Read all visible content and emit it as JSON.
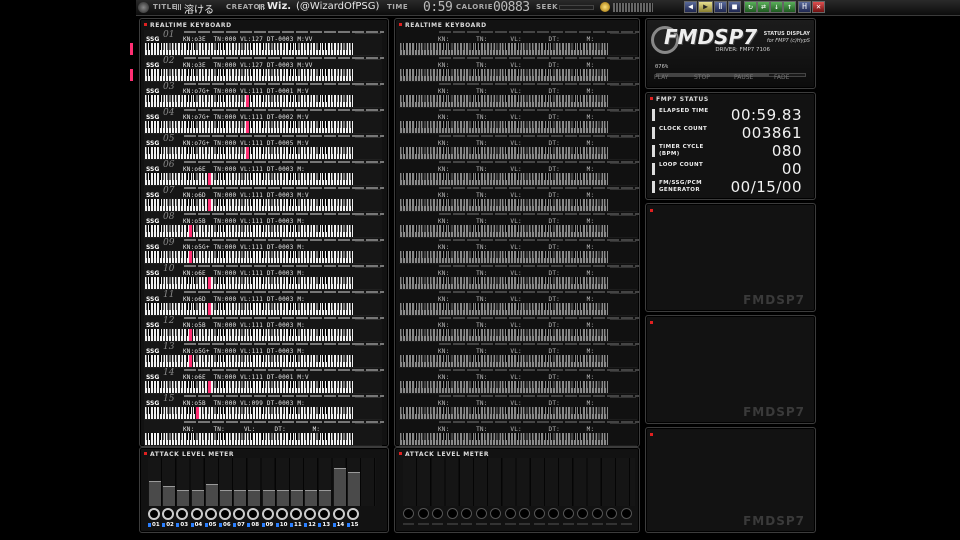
{
  "topbar": {
    "title_label": "TITLE",
    "title_value": "溶ける",
    "creator_label": "CREATOR",
    "creator_value": "Wiz.",
    "creator_handle": "(@WizardOfPSG)",
    "time_label": "TIME",
    "time_value": "0:59",
    "calorie_label": "CALORIE",
    "calorie_value": "00883",
    "seek_label": "SEEK"
  },
  "left_keyboard": {
    "title": "REALTIME KEYBOARD",
    "rows": [
      {
        "label": "SSG",
        "num": "01",
        "info": "KN:o3E  TN:000 VL:127 DT-0003 M:VV"
      },
      {
        "label": "SSG",
        "num": "02",
        "info": "KN:o3E  TN:000 VL:127 DT-0003 M:VV"
      },
      {
        "label": "SSG",
        "num": "03",
        "info": "KN:o7G+ TN:000 VL:111 DT-0001 M:V"
      },
      {
        "label": "SSG",
        "num": "04",
        "info": "KN:o7G+ TN:000 VL:111 DT-0002 M:V"
      },
      {
        "label": "SSG",
        "num": "05",
        "info": "KN:o7G+ TN:000 VL:111 DT-0005 M:V"
      },
      {
        "label": "SSG",
        "num": "06",
        "info": "KN:o6E  TN:000 VL:111 DT-0003 M:"
      },
      {
        "label": "SSG",
        "num": "07",
        "info": "KN:o6D  TN:000 VL:111 DT-0003 M:V"
      },
      {
        "label": "SSG",
        "num": "08",
        "info": "KN:o5B  TN:000 VL:111 DT-0003 M:"
      },
      {
        "label": "SSG",
        "num": "09",
        "info": "KN:o5G+ TN:000 VL:111 DT-0003 M:"
      },
      {
        "label": "SSG",
        "num": "10",
        "info": "KN:o6E  TN:000 VL:111 DT-0003 M:"
      },
      {
        "label": "SSG",
        "num": "11",
        "info": "KN:o6D  TN:000 VL:111 DT-0003 M:"
      },
      {
        "label": "SSG",
        "num": "12",
        "info": "KN:o5B  TN:000 VL:111 DT-0003 M:"
      },
      {
        "label": "SSG",
        "num": "13",
        "info": "KN:o5G+ TN:000 VL:111 DT-0003 M:"
      },
      {
        "label": "SSG",
        "num": "14",
        "info": "KN:o6E  TN:000 VL:111 DT-0001 M:V"
      },
      {
        "label": "SSG",
        "num": "15",
        "info": "KN:o5B  TN:000 VL:099 DT-0003 M:"
      },
      {
        "label": "",
        "num": "",
        "info": "KN:     TN:     VL:     DT:       M:"
      }
    ]
  },
  "right_keyboard": {
    "title": "REALTIME KEYBOARD",
    "row_info": "KN:       TN:      VL:       DT:       M:"
  },
  "left_meter": {
    "title": "ATTACK LEVEL METER",
    "levels": [
      0.52,
      0.42,
      0.34,
      0.34,
      0.46,
      0.34,
      0.34,
      0.34,
      0.34,
      0.34,
      0.34,
      0.34,
      0.34,
      0.8,
      0.7
    ],
    "labels": [
      "01",
      "02",
      "03",
      "04",
      "05",
      "06",
      "07",
      "08",
      "09",
      "10",
      "11",
      "12",
      "13",
      "14",
      "15"
    ]
  },
  "right_meter": {
    "title": "ATTACK LEVEL METER"
  },
  "logo": {
    "text": "FMDSP7",
    "sub1": "STATUS DISPLAY",
    "sub2": "for FMP7 (c)HypS",
    "driver": "DRIVER: FMP7 7106",
    "progress": "076%",
    "progress_value": 0.76,
    "buttons": [
      "PLAY",
      "STOP",
      "PAUSE",
      "FADE"
    ]
  },
  "status": {
    "title": "FMP7 STATUS",
    "rows": [
      {
        "label": "ELAPSED TIME",
        "value": "00:59.83"
      },
      {
        "label": "CLOCK COUNT",
        "value": "003861"
      },
      {
        "label": "TIMER CYCLE\n(BPM)",
        "value": "080"
      },
      {
        "label": "LOOP COUNT",
        "value": "00"
      },
      {
        "label": "FM/SSG/PCM\nGENERATOR",
        "value": "00/15/00"
      }
    ]
  },
  "watermark": "FMDSP7"
}
